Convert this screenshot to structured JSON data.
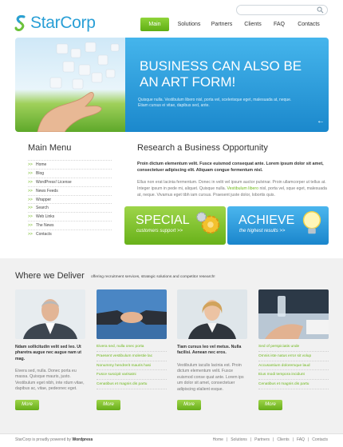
{
  "brand": {
    "name": "StarCorp"
  },
  "search": {
    "placeholder": ""
  },
  "nav": [
    "Main",
    "Solutions",
    "Partners",
    "Clients",
    "FAQ",
    "Contacts"
  ],
  "banner": {
    "title": "BUSINESS CAN ALSO BE AN ART FORM!",
    "text": "Quisque nulla. Vestibulum libero nisl, porta vel, scelerisque eget, malesuada at, neque. Etiam cursus ei vitae, dapibus sed, ante.",
    "prev": "←",
    "next": "→"
  },
  "menu": {
    "title": "Main Menu",
    "items": [
      "Home",
      "Blog",
      "WordPress! License",
      "News Feeds",
      "Wrapper",
      "Search",
      "Web Links",
      "The News",
      "Contacts"
    ],
    "arrow": ">>"
  },
  "research": {
    "title": "Research a Business Opportunity",
    "bold": "Proin dictum elementum velit. Fusce euismod consequat ante. Lorem ipsum dolor sit amet, consectetuer adipiscing elit. Aliquam congue fermentum nisl.",
    "text_a": "Ellus non erat lacinia fermentum. Donec in velit vel ipsum auctor pulvinar. Proin ullamcorper ut tellus at. Integer ipsum in pede mi, aliquet. Quisque nulla.",
    "link": "Vestibulum libero",
    "text_b": "nisl, porta vel, sque eget, malesuada at, neque. Vivamus eget tibh iam cursus. Praesent juste dolor, lobortis quis."
  },
  "promos": [
    {
      "title": "SPECIAL",
      "sub": "customers support >>"
    },
    {
      "title": "ACHIEVE",
      "sub": "the highest results >>"
    }
  ],
  "deliver": {
    "title": "Where we Deliver",
    "sub": "offering recruitment services, strategic solutions and competitor research!",
    "cards": [
      {
        "bold": "Ndam sollicitudin velit sed leo. Ut pharetra augue nec augue nam ut mag.",
        "text": "Eivera sed, nulla. Donec porta eu massa. Quisque mauris, justo. Vestibulum eget nibh, inte rdum vitae, dapibus ac, vitae, pedeonec eget.",
        "more": "More"
      },
      {
        "links": [
          "Eivera sed, nulla onec porta",
          "Praesent vestibulum molestie lac",
          "Nonummy hendrerit mauris hasi",
          "Fusce suscipit varisatni",
          "Cenatibus et magnis dis partu"
        ],
        "more": "More"
      },
      {
        "bold": "Tiam cursus leo vel metus. Nulla facilisi. Aenean nec eros.",
        "text": "Vestibulum iaculis lacinia est. Proin dictum elementum velit. Fusce euismod conse quat ante. Lorem ips um dolor sit amet, consectetuer adipiscing elalient esque.",
        "more": "More"
      },
      {
        "links": [
          "Sed of perspiciatis unde",
          "Omnis iste natus error sit volup",
          "Accusantium doloremque laud",
          "Eius modi tempora incidunt",
          "Cenatibus et magnis dis partu"
        ],
        "more": "More"
      }
    ]
  },
  "footer": {
    "copy": "StarCorp is proudly powered by",
    "copy_bold": "Wordpress",
    "links": [
      "Home",
      "|",
      "Solutions",
      "|",
      "Partners",
      "|",
      "Clients",
      "|",
      "FAQ",
      "|",
      "Contacts"
    ]
  },
  "colors": {
    "green": "#6fb81c",
    "blue": "#1b88cc",
    "brand_blue": "#2a9fd6"
  }
}
